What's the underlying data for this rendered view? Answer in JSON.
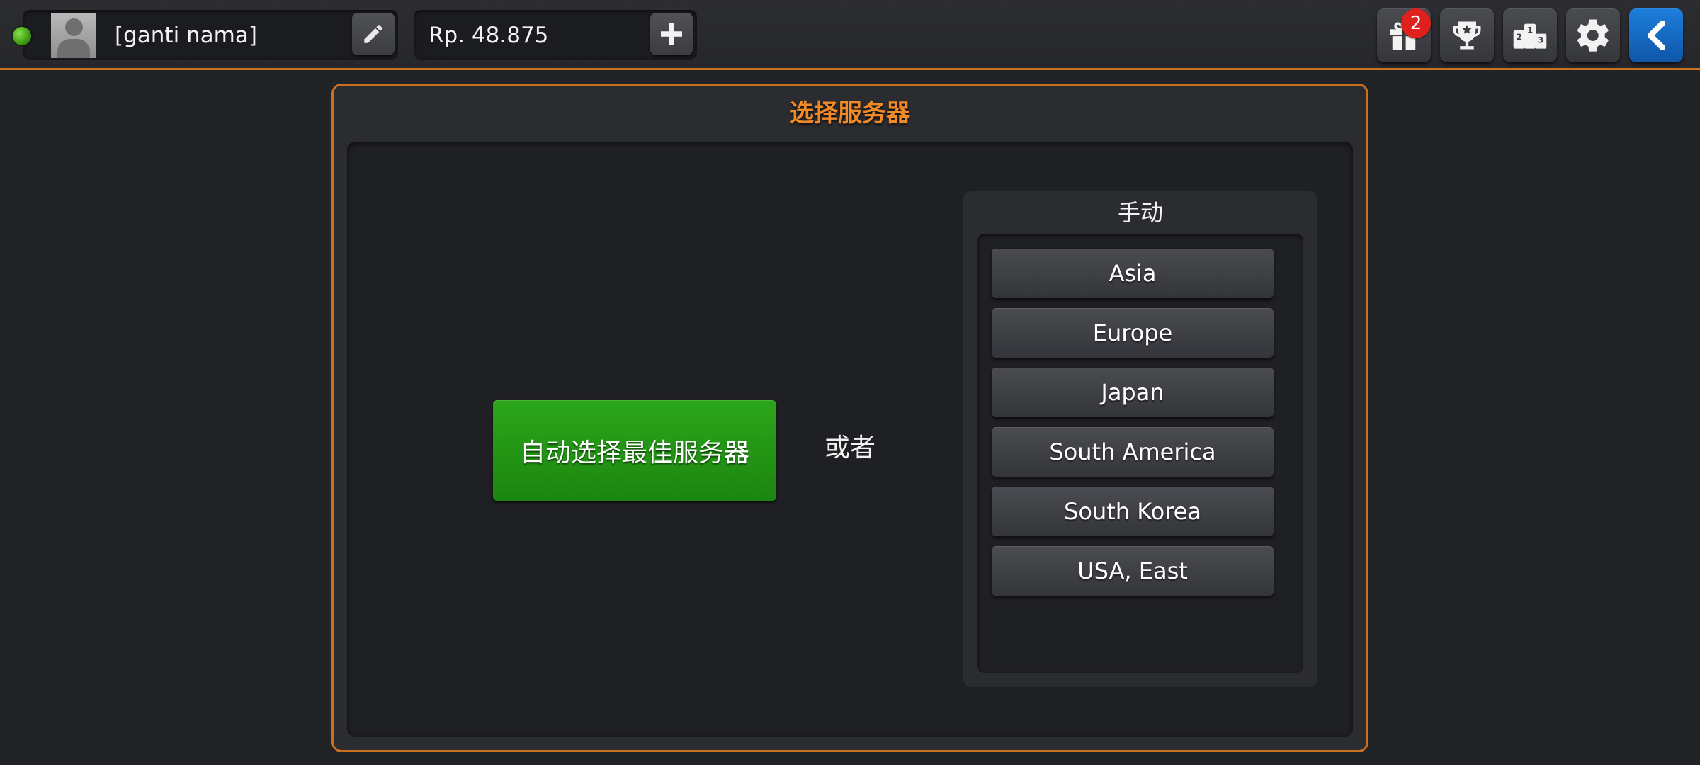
{
  "topbar": {
    "player_name": "[ganti nama]",
    "currency": "Rp. 48.875",
    "gift_badge_count": "2",
    "icons": {
      "status": "online-status-icon",
      "avatar": "avatar-placeholder-icon",
      "edit": "pencil-icon",
      "add": "plus-icon",
      "gift": "gift-icon",
      "trophy": "trophy-icon",
      "leaderboard": "podium-icon",
      "settings": "gear-icon",
      "back": "chevron-left-icon"
    },
    "colors": {
      "accent": "#c9711e",
      "status_online": "#5cc024",
      "badge": "#e0201d",
      "back_button": "#1a73cc"
    }
  },
  "dialog": {
    "title": "选择服务器",
    "auto_button_label": "自动选择最佳服务器",
    "or_label": "或者",
    "manual_title": "手动",
    "servers": [
      "Asia",
      "Europe",
      "Japan",
      "South America",
      "South Korea",
      "USA, East"
    ],
    "colors": {
      "title": "#f08a28",
      "auto_button": "#22961a"
    }
  }
}
